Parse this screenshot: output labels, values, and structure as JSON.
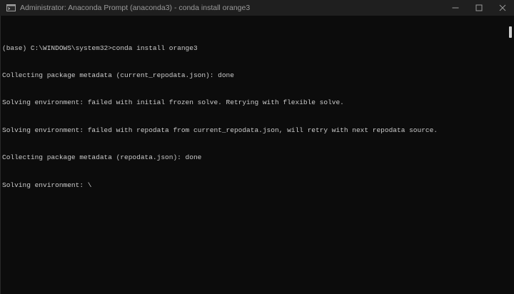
{
  "window": {
    "title": "Administrator: Anaconda Prompt (anaconda3) - conda  install orange3",
    "icon": "terminal-icon",
    "controls": {
      "minimize": "minimize-icon",
      "maximize": "maximize-icon",
      "close": "close-icon"
    }
  },
  "console": {
    "lines": [
      "(base) C:\\WINDOWS\\system32>conda install orange3",
      "Collecting package metadata (current_repodata.json): done",
      "Solving environment: failed with initial frozen solve. Retrying with flexible solve.",
      "Solving environment: failed with repodata from current_repodata.json, will retry with next repodata source.",
      "Collecting package metadata (repodata.json): done",
      "Solving environment: \\"
    ]
  },
  "colors": {
    "background": "#0c0c0c",
    "titlebar": "#1f1f1f",
    "text": "#cccccc"
  }
}
